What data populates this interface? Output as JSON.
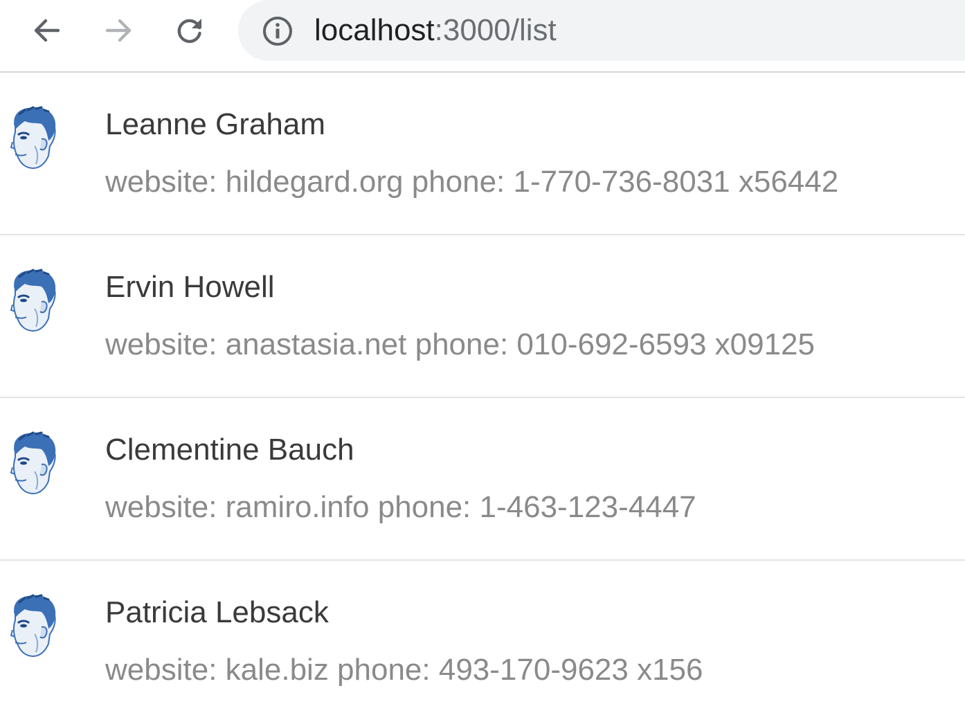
{
  "browser": {
    "back_icon": "arrow-left-icon",
    "forward_icon": "arrow-right-icon",
    "reload_icon": "reload-icon",
    "info_icon": "info-circle-icon",
    "url_host": "localhost",
    "url_rest": ":3000/list"
  },
  "list": {
    "items": [
      {
        "name": "Leanne Graham",
        "description": "website: hildegard.org phone: 1-770-736-8031 x56442"
      },
      {
        "name": "Ervin Howell",
        "description": "website: anastasia.net phone: 010-692-6593 x09125"
      },
      {
        "name": "Clementine Bauch",
        "description": "website: ramiro.info phone: 1-463-123-4447"
      },
      {
        "name": "Patricia Lebsack",
        "description": "website: kale.biz phone: 493-170-9623 x156"
      }
    ]
  },
  "colors": {
    "avatar_blue": "#3b6fb6",
    "omnibox_bg": "#f1f3f4"
  }
}
